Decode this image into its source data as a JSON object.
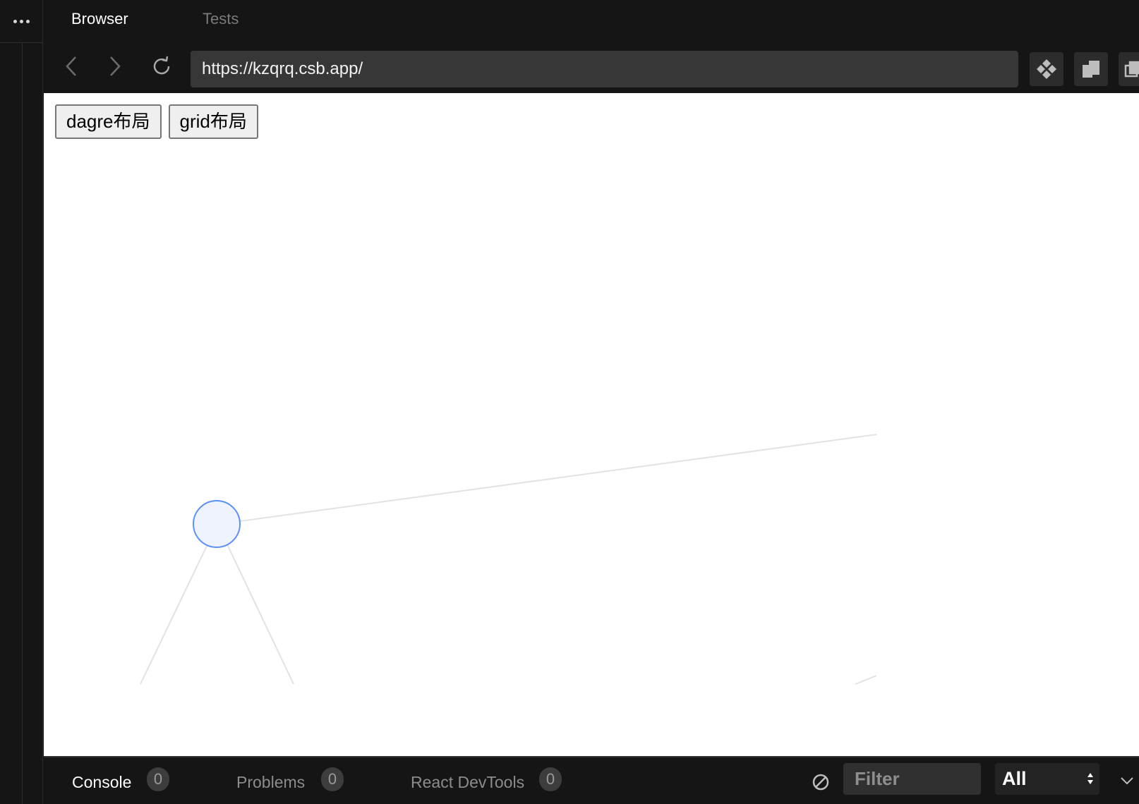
{
  "tabs": {
    "browser": "Browser",
    "tests": "Tests"
  },
  "address_bar": {
    "url": "https://kzqrq.csb.app/"
  },
  "page": {
    "buttons": {
      "dagre": "dagre布局",
      "grid": "grid布局"
    }
  },
  "colors": {
    "node_fill": "#eef3fd",
    "node_stroke": "#5b8ff9",
    "edge": "#e2e2e2"
  },
  "bottom_panel": {
    "tabs": [
      {
        "label": "Console",
        "count": "0"
      },
      {
        "label": "Problems",
        "count": "0"
      },
      {
        "label": "React DevTools",
        "count": "0"
      }
    ],
    "filter_placeholder": "Filter",
    "level_value": "All"
  }
}
